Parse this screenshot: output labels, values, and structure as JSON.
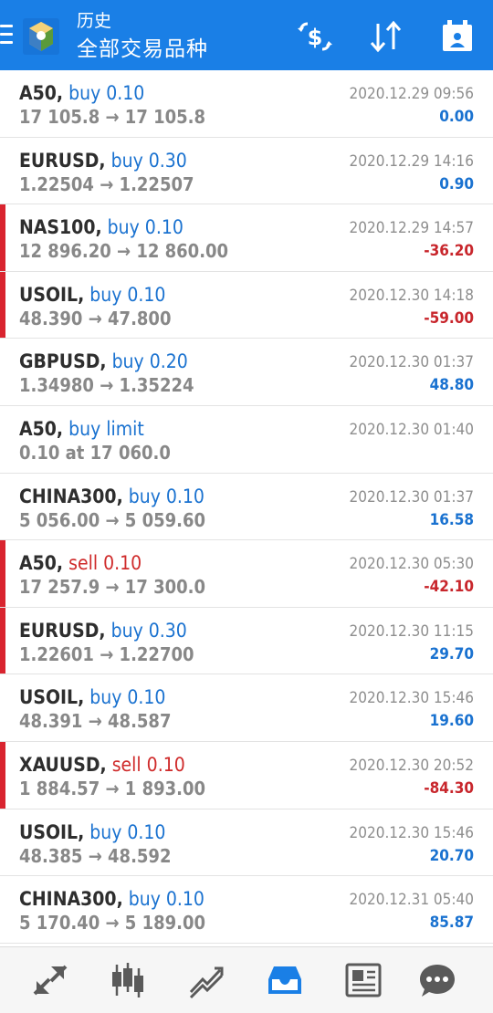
{
  "header": {
    "subtitle": "历史",
    "title": "全部交易品种",
    "buttons": [
      {
        "name": "currency-exchange-icon"
      },
      {
        "name": "sort-icon"
      },
      {
        "name": "period-calendar-icon"
      }
    ]
  },
  "colors": {
    "header_bg": "#1a7fe6",
    "buy": "#1a72d0",
    "sell": "#cf2a2a",
    "profit_positive": "#1a72d0",
    "profit_negative": "#c8262c",
    "loss_marker": "#d9242f",
    "active_nav": "#1a7fe6"
  },
  "deals": [
    {
      "symbol": "A50,",
      "side": "buy 0.10",
      "side_type": "buy",
      "prices": "17 105.8 → 17 105.8",
      "time": "2020.12.29 09:56",
      "profit": "0.00",
      "profit_type": "pos",
      "loss": false
    },
    {
      "symbol": "EURUSD,",
      "side": "buy 0.30",
      "side_type": "buy",
      "prices": "1.22504 → 1.22507",
      "time": "2020.12.29 14:16",
      "profit": "0.90",
      "profit_type": "pos",
      "loss": false
    },
    {
      "symbol": "NAS100,",
      "side": "buy 0.10",
      "side_type": "buy",
      "prices": "12 896.20 → 12 860.00",
      "time": "2020.12.29 14:57",
      "profit": "-36.20",
      "profit_type": "neg",
      "loss": true
    },
    {
      "symbol": "USOIL,",
      "side": "buy 0.10",
      "side_type": "buy",
      "prices": "48.390 → 47.800",
      "time": "2020.12.30 14:18",
      "profit": "-59.00",
      "profit_type": "neg",
      "loss": true
    },
    {
      "symbol": "GBPUSD,",
      "side": "buy 0.20",
      "side_type": "buy",
      "prices": "1.34980 → 1.35224",
      "time": "2020.12.30 01:37",
      "profit": "48.80",
      "profit_type": "pos",
      "loss": false
    },
    {
      "symbol": "A50,",
      "side": "buy limit",
      "side_type": "buy",
      "prices": "0.10 at 17 060.0",
      "time": "2020.12.30 01:40",
      "profit": "",
      "profit_type": "pos",
      "loss": false
    },
    {
      "symbol": "CHINA300,",
      "side": "buy 0.10",
      "side_type": "buy",
      "prices": "5 056.00 → 5 059.60",
      "time": "2020.12.30 01:37",
      "profit": "16.58",
      "profit_type": "pos",
      "loss": false
    },
    {
      "symbol": "A50,",
      "side": "sell 0.10",
      "side_type": "sell",
      "prices": "17 257.9 → 17 300.0",
      "time": "2020.12.30 05:30",
      "profit": "-42.10",
      "profit_type": "neg",
      "loss": true
    },
    {
      "symbol": "EURUSD,",
      "side": "buy 0.30",
      "side_type": "buy",
      "prices": "1.22601 → 1.22700",
      "time": "2020.12.30 11:15",
      "profit": "29.70",
      "profit_type": "pos",
      "loss": true
    },
    {
      "symbol": "USOIL,",
      "side": "buy 0.10",
      "side_type": "buy",
      "prices": "48.391 → 48.587",
      "time": "2020.12.30 15:46",
      "profit": "19.60",
      "profit_type": "pos",
      "loss": false
    },
    {
      "symbol": "XAUUSD,",
      "side": "sell 0.10",
      "side_type": "sell",
      "prices": "1 884.57 → 1 893.00",
      "time": "2020.12.30 20:52",
      "profit": "-84.30",
      "profit_type": "neg",
      "loss": true
    },
    {
      "symbol": "USOIL,",
      "side": "buy 0.10",
      "side_type": "buy",
      "prices": "48.385 → 48.592",
      "time": "2020.12.30 15:46",
      "profit": "20.70",
      "profit_type": "pos",
      "loss": false
    },
    {
      "symbol": "CHINA300,",
      "side": "buy 0.10",
      "side_type": "buy",
      "prices": "5 170.40 → 5 189.00",
      "time": "2020.12.31 05:40",
      "profit": "85.87",
      "profit_type": "pos",
      "loss": false
    }
  ],
  "bottom_nav": [
    {
      "name": "nav-quotes-icon",
      "active": false
    },
    {
      "name": "nav-chart-icon",
      "active": false
    },
    {
      "name": "nav-trade-icon",
      "active": false
    },
    {
      "name": "nav-history-icon",
      "active": true
    },
    {
      "name": "nav-news-icon",
      "active": false
    },
    {
      "name": "nav-messages-icon",
      "active": false
    }
  ]
}
